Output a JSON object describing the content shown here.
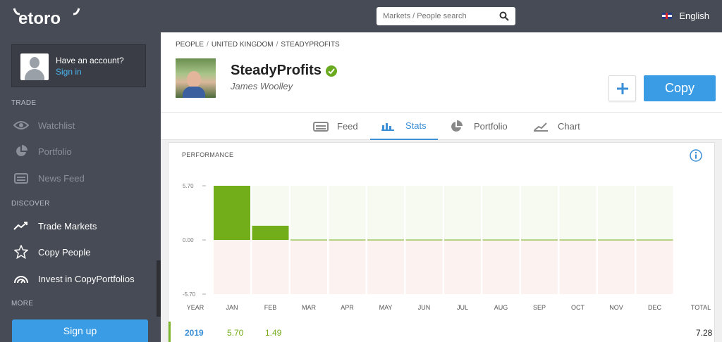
{
  "app": {
    "logo_text": "etoro"
  },
  "sidebar": {
    "account": {
      "title": "Have an account?",
      "sign_in": "Sign in"
    },
    "trade_heading": "TRADE",
    "trade_items": [
      {
        "label": "Watchlist",
        "icon": "eye-icon"
      },
      {
        "label": "Portfolio",
        "icon": "pie-chart-icon"
      },
      {
        "label": "News Feed",
        "icon": "news-icon"
      }
    ],
    "discover_heading": "DISCOVER",
    "discover_items": [
      {
        "label": "Trade Markets",
        "icon": "trend-up-icon"
      },
      {
        "label": "Copy People",
        "icon": "star-icon"
      },
      {
        "label": "Invest in CopyPortfolios",
        "icon": "copyportfolio-icon"
      }
    ],
    "more_heading": "MORE",
    "signup_label": "Sign up"
  },
  "topbar": {
    "search_placeholder": "Markets / People search",
    "language": "English"
  },
  "profile": {
    "breadcrumb": [
      "PEOPLE",
      "UNITED KINGDOM",
      "STEADYPROFITS"
    ],
    "username": "SteadyProfits",
    "real_name": "James Woolley",
    "plus_label": "+",
    "copy_label": "Copy"
  },
  "tabs": [
    {
      "label": "Feed",
      "icon": "feed-icon",
      "active": false
    },
    {
      "label": "Stats",
      "icon": "bar-chart-icon",
      "active": true
    },
    {
      "label": "Portfolio",
      "icon": "pie-chart-icon",
      "active": false
    },
    {
      "label": "Chart",
      "icon": "line-chart-icon",
      "active": false
    }
  ],
  "performance": {
    "title": "PERFORMANCE",
    "colors": {
      "positive": "#72ad1a",
      "positive_bg": "#f6faf1",
      "negative_bg": "#fcf2f0",
      "accent": "#3b9ce6"
    }
  },
  "chart_data": {
    "type": "bar",
    "categories": [
      "JAN",
      "FEB",
      "MAR",
      "APR",
      "MAY",
      "JUN",
      "JUL",
      "AUG",
      "SEP",
      "OCT",
      "NOV",
      "DEC"
    ],
    "values": [
      5.7,
      1.49,
      0,
      0,
      0,
      0,
      0,
      0,
      0,
      0,
      0,
      0
    ],
    "ylim": [
      -5.7,
      5.7
    ],
    "yticks": [
      "5.70",
      "0.00",
      "-5.70"
    ],
    "first_col_label": "YEAR",
    "last_col_label": "TOTAL",
    "xlabel": "",
    "ylabel": ""
  },
  "year_row": {
    "year": "2019",
    "jan": "5.70",
    "feb": "1.49",
    "total": "7.28"
  }
}
